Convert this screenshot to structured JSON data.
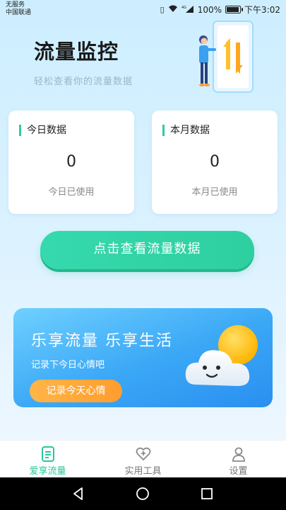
{
  "status": {
    "carrier_line1": "无服务",
    "carrier_line2": "中国联通",
    "signal_label": "4G",
    "battery": "100%",
    "battery_level": 1.0,
    "time": "下午3:02"
  },
  "header": {
    "title": "流量监控",
    "subtitle": "轻松查看你的流量数据"
  },
  "stats": {
    "today": {
      "title": "今日数据",
      "value": "0",
      "label": "今日已使用"
    },
    "month": {
      "title": "本月数据",
      "value": "0",
      "label": "本月已使用"
    }
  },
  "main_button": "点击查看流量数据",
  "banner": {
    "title": "乐享流量 乐享生活",
    "subtitle": "记录下今日心情吧",
    "button": "记录今天心情"
  },
  "bottom_nav": {
    "items": [
      {
        "label": "爱享流量",
        "icon": "document-icon",
        "active": true
      },
      {
        "label": "实用工具",
        "icon": "heart-plus-icon",
        "active": false
      },
      {
        "label": "设置",
        "icon": "person-icon",
        "active": false
      }
    ]
  },
  "colors": {
    "accent": "#2ecf9f",
    "banner_blue": "#3aa7f6",
    "orange": "#ff9d2e"
  }
}
